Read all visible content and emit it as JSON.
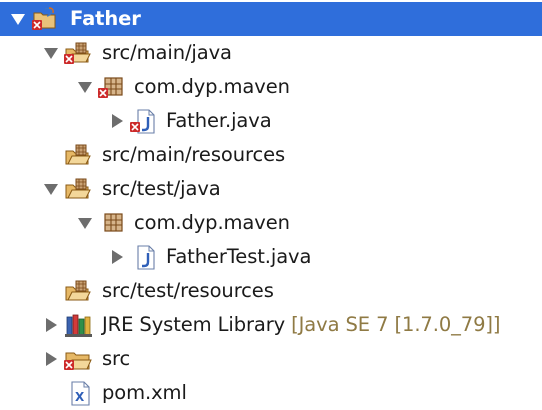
{
  "tree": {
    "rows": [
      {
        "label": "Father",
        "expanded": true,
        "selected": true,
        "error": true,
        "icon": "java-project-icon"
      },
      {
        "label": "src/main/java",
        "expanded": true,
        "error": true,
        "icon": "source-folder-icon"
      },
      {
        "label": "com.dyp.maven",
        "expanded": true,
        "error": true,
        "icon": "package-icon"
      },
      {
        "label": "Father.java",
        "expanded": false,
        "error": true,
        "icon": "java-file-icon"
      },
      {
        "label": "src/main/resources",
        "icon": "source-folder-icon"
      },
      {
        "label": "src/test/java",
        "expanded": true,
        "icon": "source-folder-icon"
      },
      {
        "label": "com.dyp.maven",
        "expanded": true,
        "icon": "package-icon"
      },
      {
        "label": "FatherTest.java",
        "expanded": false,
        "icon": "java-file-icon"
      },
      {
        "label": "src/test/resources",
        "icon": "source-folder-icon"
      },
      {
        "label": "JRE System Library",
        "decoration": "[Java SE 7 [1.7.0_79]]",
        "expanded": false,
        "icon": "library-icon"
      },
      {
        "label": "src",
        "expanded": false,
        "error": true,
        "icon": "folder-icon"
      },
      {
        "label": "pom.xml",
        "icon": "xml-file-icon"
      }
    ]
  },
  "colors": {
    "selection": "#2f6edb",
    "error": "#cc2b2b",
    "decoration": "#8f7a44"
  }
}
